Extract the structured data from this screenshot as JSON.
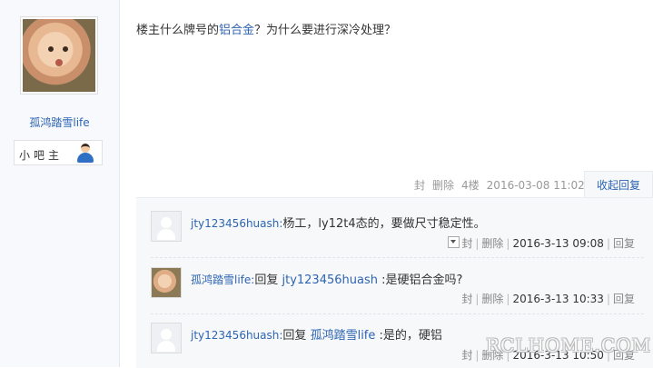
{
  "author": {
    "name": "孤鸿踏雪life",
    "role": "小吧主"
  },
  "post": {
    "text_before": "楼主什么牌号的",
    "link": "铝合金",
    "text_after": "？为什么要进行深冷处理？"
  },
  "meta": {
    "seal": "封",
    "delete": "删除",
    "floor": "4楼",
    "datetime": "2016-03-08 11:02",
    "collapse_reply": "收起回复"
  },
  "replies": [
    {
      "user": "jty123456huash:",
      "text": "杨工，ly12t4态的，要做尺寸稳定性。",
      "seal": "封",
      "delete": "删除",
      "datetime": "2016-3-13 09:08",
      "reply": "回复"
    },
    {
      "user": "孤鸿踏雪life:",
      "reply_word": "回复",
      "target": "jty123456huash",
      "text": ":是硬铝合金吗?",
      "seal": "封",
      "delete": "删除",
      "datetime": "2016-3-13 10:33",
      "reply": "回复"
    },
    {
      "user": "jty123456huash:",
      "reply_word": "回复",
      "target": "孤鸿踏雪life",
      "text": ":是的，硬铝",
      "seal": "封",
      "delete": "删除",
      "datetime": "2016-3-13 10:50",
      "reply": "回复"
    }
  ],
  "watermark": "RCLHOME.COM"
}
